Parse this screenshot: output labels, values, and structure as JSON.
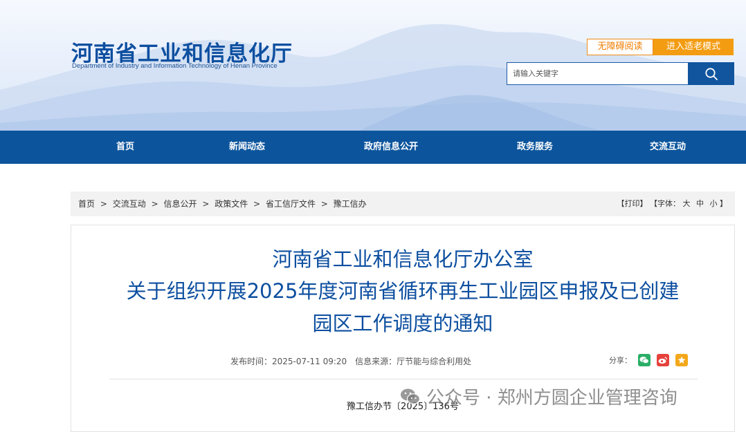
{
  "header": {
    "site_title": "河南省工业和信息化厅",
    "site_subtitle": "Department of Industry and Information Technology of Henan Province",
    "accessibility_label": "无障碍阅读",
    "elder_mode_label": "进入适老模式",
    "search_placeholder": "请输入关键字",
    "search_icon": "search-icon"
  },
  "nav": {
    "items": [
      "首页",
      "新闻动态",
      "政府信息公开",
      "政务服务",
      "交流互动"
    ]
  },
  "breadcrumb": {
    "items": [
      "首页",
      "交流互动",
      "信息公开",
      "政策文件",
      "省工信厅文件",
      "豫工信办"
    ],
    "separator": ">",
    "print_label": "【打印】",
    "font_label": "【字体：",
    "font_large": "大",
    "font_medium": "中",
    "font_small": "小",
    "font_close": "】"
  },
  "article": {
    "title_line1": "河南省工业和信息化厅办公室",
    "title_line2": "关于组织开展2025年度河南省循环再生工业园区申报及已创建",
    "title_line3": "园区工作调度的通知",
    "publish_label": "发布时间：",
    "publish_time": "2025-07-11 09:20",
    "source_label": "信息来源：",
    "source": "厅节能与综合利用处",
    "share_label": "分享：",
    "share_icons": [
      "wechat-icon",
      "weibo-icon",
      "favorite-icon"
    ],
    "doc_number": "豫工信办节〔2025〕136号"
  },
  "watermark": {
    "text": "公众号 · 郑州方圆企业管理咨询"
  },
  "colors": {
    "brand_blue": "#0c559d",
    "title_blue": "#0d4fa0",
    "accent_orange": "#f39c12"
  }
}
